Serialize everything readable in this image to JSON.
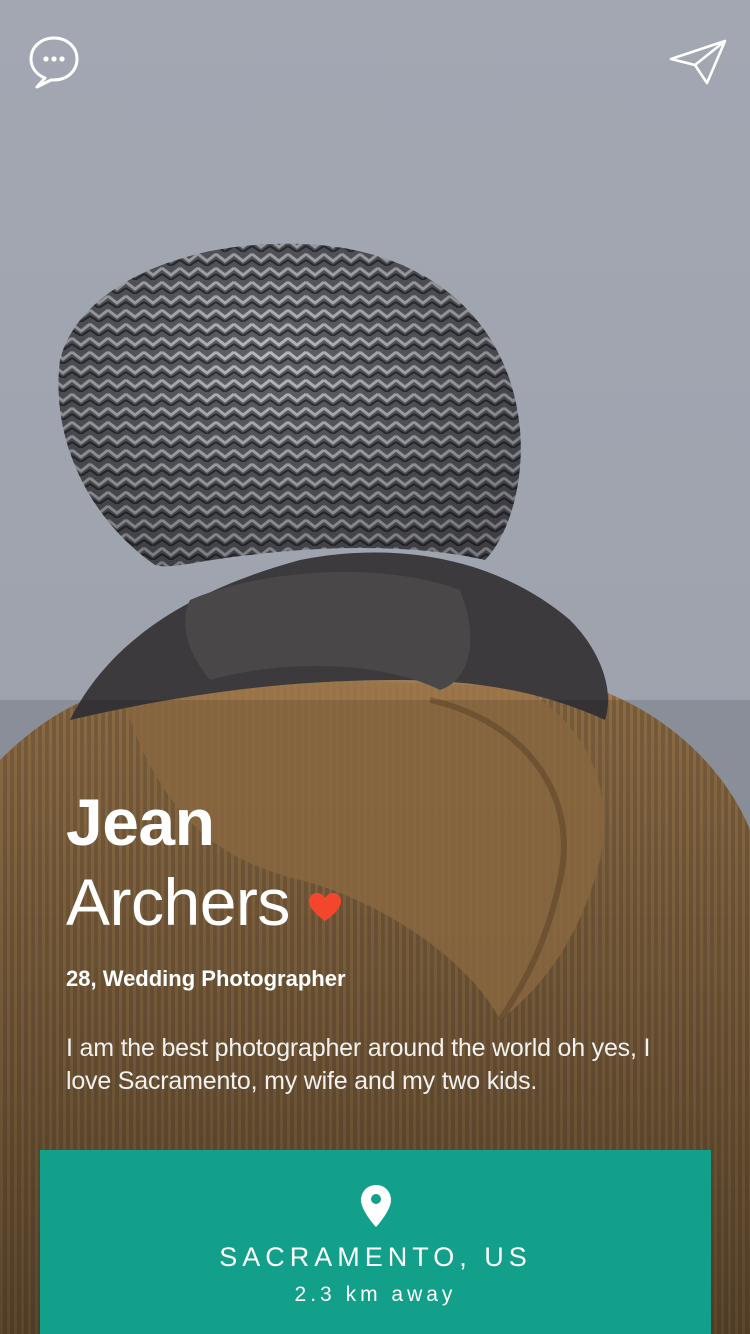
{
  "header": {
    "chat_icon": "chat-bubble-ellipsis-icon",
    "send_icon": "paper-plane-icon"
  },
  "profile": {
    "first_name": "Jean",
    "last_name": "Archers",
    "heart_icon": "heart-icon",
    "subtitle": "28, Wedding Photographer",
    "bio": "I am the best photographer around the world oh yes, I love Sacramento, my wife and my two kids."
  },
  "location": {
    "pin_icon": "location-pin-icon",
    "city": "SACRAMENTO, US",
    "distance": "2.3 km away"
  },
  "colors": {
    "accent_teal": "#13a08b",
    "heart_red": "#f4462c"
  }
}
